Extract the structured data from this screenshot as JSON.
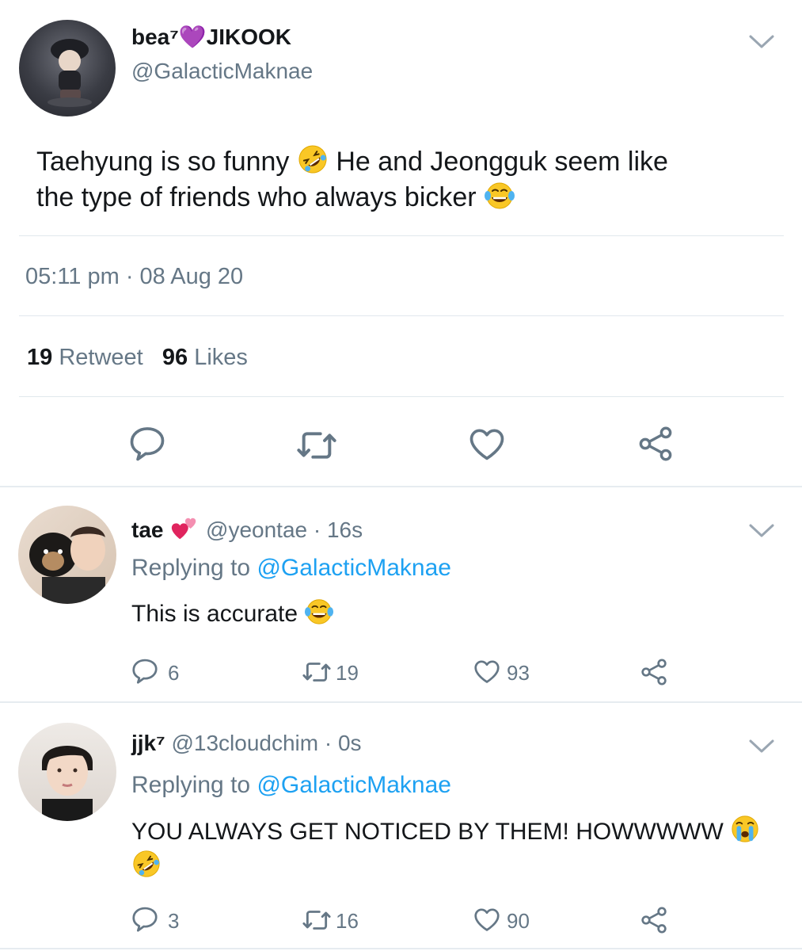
{
  "main_tweet": {
    "display_name": "bea⁷💜JIKOOK",
    "handle": "@GalacticMaknae",
    "text_line1_part1": "Taehyung is so funny",
    "text_line1_part2": "He and Jeongguk seem like",
    "text_line2": "the type of friends who always bicker",
    "timestamp": "05:11 pm · 08 Aug 20",
    "retweet_count": "19",
    "retweet_label": "Retweet",
    "likes_count": "96",
    "likes_label": "Likes",
    "icons": [
      "reply-icon",
      "retweet-icon",
      "like-icon",
      "share-icon"
    ]
  },
  "replies": [
    {
      "display_name": "tae",
      "name_emoji": "💞",
      "handle_time": "@yeontae · 16s",
      "replying_label": "Replying to",
      "replying_handle": "@GalacticMaknae",
      "text": "This is accurate",
      "reply_count": "6",
      "retweet_count": "19",
      "like_count": "93"
    },
    {
      "display_name": "jjk⁷",
      "handle_time": "@13cloudchim · 0s",
      "replying_label": "Replying to",
      "replying_handle": "@GalacticMaknae",
      "text": "YOU ALWAYS GET NOTICED BY THEM! HOWWWWW",
      "reply_count": "3",
      "retweet_count": "16",
      "like_count": "90"
    }
  ],
  "colors": {
    "text": "#14171a",
    "secondary": "#657786",
    "link": "#1da1f2",
    "divider": "#e1e8ed"
  }
}
